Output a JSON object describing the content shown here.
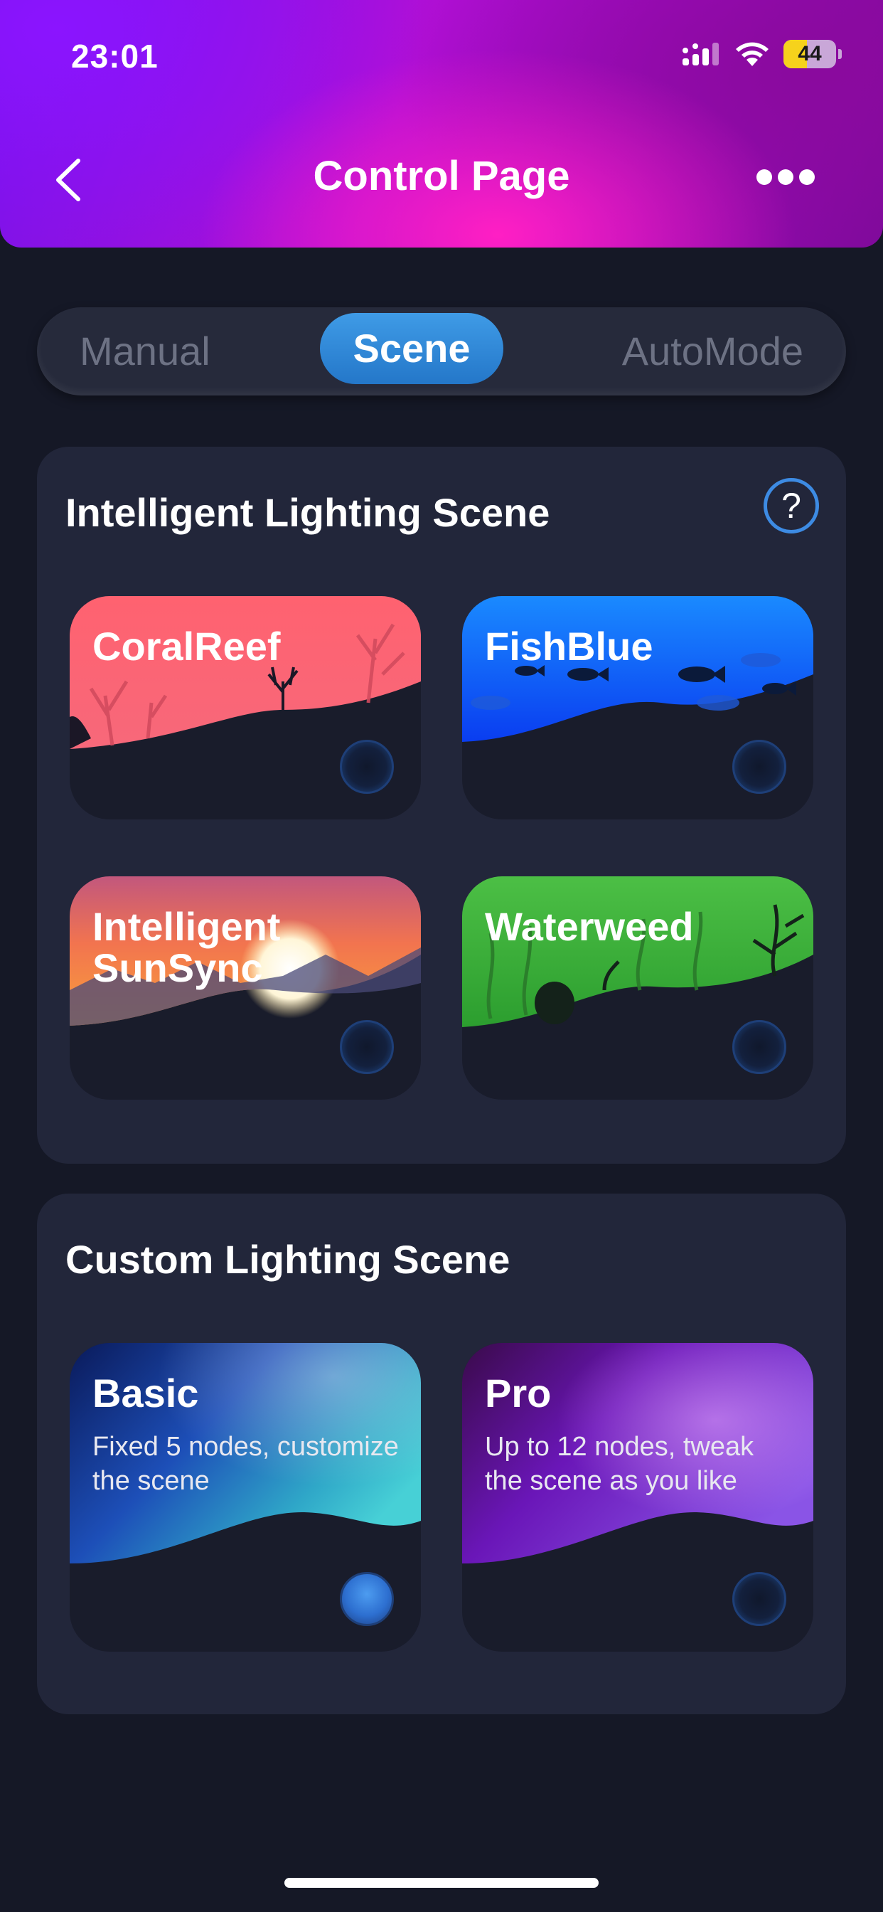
{
  "status_bar": {
    "time": "23:01",
    "battery": "44"
  },
  "header": {
    "title": "Control Page"
  },
  "tabs": {
    "manual": "Manual",
    "scene": "Scene",
    "automode": "AutoMode",
    "active": "Scene"
  },
  "intelligent": {
    "title": "Intelligent Lighting Scene",
    "help_icon": "?",
    "scenes": [
      {
        "name": "CoralReef",
        "selected": false
      },
      {
        "name": "FishBlue",
        "selected": false
      },
      {
        "name": "Intelligent SunSync",
        "selected": false
      },
      {
        "name": "Waterweed",
        "selected": false
      }
    ]
  },
  "custom": {
    "title": "Custom Lighting Scene",
    "scenes": [
      {
        "name": "Basic",
        "desc": "Fixed 5 nodes, customize the scene",
        "selected": true
      },
      {
        "name": "Pro",
        "desc": "Up to 12 nodes, tweak the scene as you like",
        "selected": false
      }
    ]
  },
  "colors": {
    "accent": "#2f86dd",
    "background": "#151826",
    "panel": "#22263a"
  }
}
